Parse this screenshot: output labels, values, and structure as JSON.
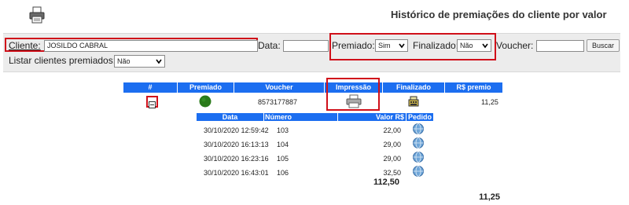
{
  "header": {
    "title": "Histórico de premiações do cliente por valor",
    "print_icon": "printer-icon"
  },
  "filters": {
    "cliente_label": "Cliente:",
    "cliente_value": "JOSILDO CABRAL",
    "data_label": "Data:",
    "data_value": "",
    "premiado_label": "Premiado:",
    "premiado_value": "Sim",
    "finalizado_label": "Finalizado:",
    "finalizado_value": "Não",
    "voucher_label": "Voucher:",
    "voucher_value": "",
    "buscar_label": "Buscar",
    "listar_label": "Listar clientes premiados:",
    "listar_value": "Não"
  },
  "table": {
    "columns": [
      "#",
      "Premiado",
      "Voucher",
      "Impressão",
      "Finalizado",
      "R$ premio"
    ],
    "row": {
      "expand_icon": "minus-box-icon",
      "premiado_icon": "green-circle-icon",
      "voucher": "8573177887",
      "impressao_icon": "printer-icon",
      "finalizado_icon": "cash-register-icon",
      "premio": "11,25"
    },
    "sub_columns": [
      "Data",
      "Número",
      "Valor R$",
      "Pedido"
    ],
    "sub_rows": [
      {
        "data": "30/10/2020 12:59:42",
        "numero": "103",
        "valor": "22,00",
        "pedido_icon": "globe-icon"
      },
      {
        "data": "30/10/2020 16:13:13",
        "numero": "104",
        "valor": "29,00",
        "pedido_icon": "globe-icon"
      },
      {
        "data": "30/10/2020 16:23:16",
        "numero": "105",
        "valor": "29,00",
        "pedido_icon": "globe-icon"
      },
      {
        "data": "30/10/2020 16:43:01",
        "numero": "106",
        "valor": "32,50",
        "pedido_icon": "globe-icon"
      }
    ],
    "sub_total": "112,50",
    "grand_total": "11,25"
  },
  "colors": {
    "header_blue": "#1c6ef0",
    "highlight_red": "#d0101a",
    "panel_gray": "#ececec",
    "status_green": "#2a7a1a"
  }
}
